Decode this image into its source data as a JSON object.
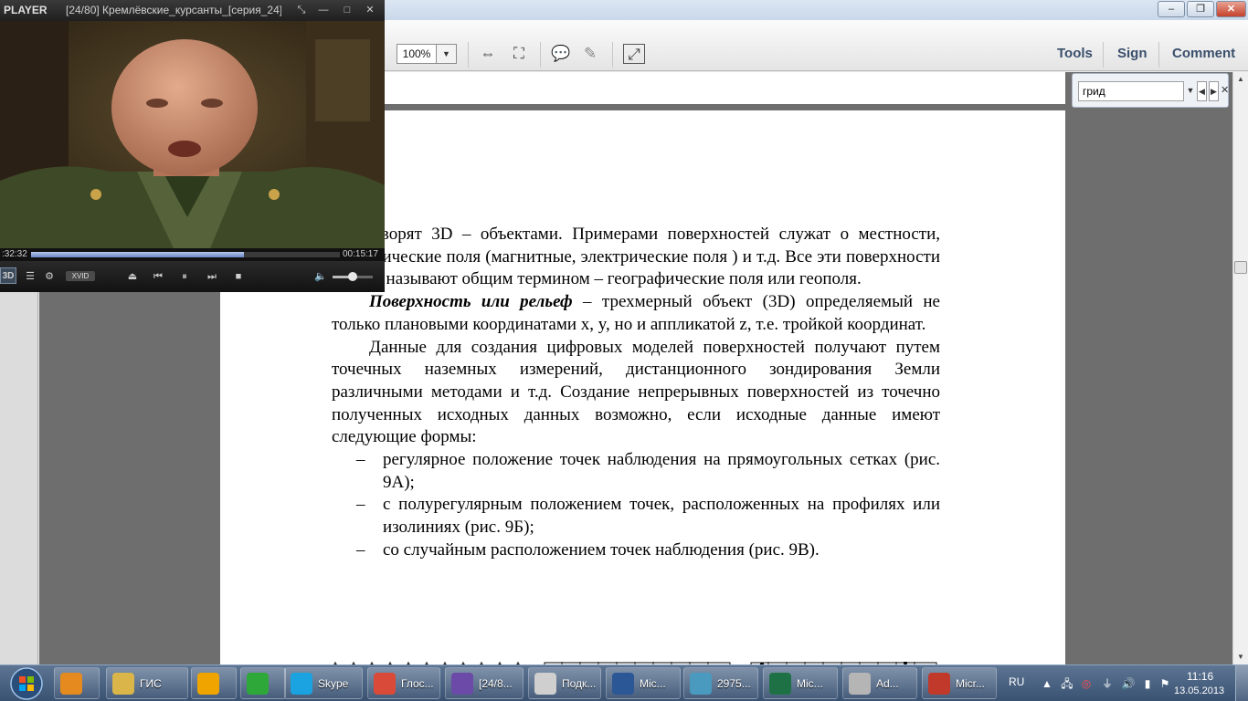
{
  "acrobat": {
    "zoom": "100%",
    "toolbar_tabs": {
      "tools": "Tools",
      "sign": "Sign",
      "comment": "Comment"
    },
    "find": {
      "query": "грид"
    }
  },
  "document": {
    "p1": "как говорят 3D – объектами. Примерами поверхностей служат о местности, геофизические поля (магнитные, электрические поля ) и т.д. Все эти поверхности иногда называют общим термином – географические поля или геополя.",
    "p2_term": "Поверхность или рельеф",
    "p2_rest": " – трехмерный объект (3D) определяемый не только плановыми координатами x, y, но и аппликатой z, т.е. тройкой координат.",
    "p3": "Данные для создания цифровых моделей поверхностей получают путем точечных наземных измерений, дистанционного зондирования Земли различными методами и т.д. Создание непрерывных поверхностей из точечно полученных исходных данных возможно, если исходные данные имеют следующие формы:",
    "bullet_dash": "–",
    "bullets": [
      "регулярное положение точек наблюдения на прямоугольных сетках (рис. 9А);",
      "с полурегулярным положением точек, расположенных на профилях или изолиниях (рис. 9Б);",
      "со случайным расположением точек наблюдения (рис. 9В)."
    ]
  },
  "player": {
    "logo": "PLAYER",
    "title": "[24/80] Кремлёвские_курсанты_[серия_24]...",
    "time_elapsed": ":32:32",
    "time_total": "00:15:17",
    "progress": 0.69,
    "volume": 0.5,
    "badge_3d": "3D",
    "codec": "XVID"
  },
  "taskbar": {
    "items": [
      {
        "label": "",
        "icon": "chat-app-icon",
        "color": "#e58a1f"
      },
      {
        "label": "ГИС",
        "icon": "folder-icon",
        "color": "#d9b54a"
      },
      {
        "label": "",
        "icon": "aimp-icon",
        "color": "#f0a400"
      },
      {
        "label": "",
        "icon": "mail-agent-icon",
        "color": "#2fa83a"
      },
      {
        "label": "Skype",
        "icon": "skype-icon",
        "color": "#1aa3e0"
      },
      {
        "label": "Глос...",
        "icon": "chrome-icon",
        "color": "#d94a38"
      },
      {
        "label": "[24/8...",
        "icon": "media-player-icon",
        "color": "#6b4aa8"
      },
      {
        "label": "Подк...",
        "icon": "document-icon",
        "color": "#cfcfcf"
      },
      {
        "label": "Mic...",
        "icon": "word-icon",
        "color": "#2b5797"
      },
      {
        "label": "2975...",
        "icon": "image-viewer-icon",
        "color": "#4a9ac0"
      },
      {
        "label": "Mic...",
        "icon": "excel-icon",
        "color": "#1e7145"
      },
      {
        "label": "Ad...",
        "icon": "ico-editor-icon",
        "color": "#b5b5b5"
      },
      {
        "label": "Micr...",
        "icon": "acrobat-icon",
        "color": "#c0392b"
      }
    ],
    "lang": "RU",
    "time": "11:16",
    "date": "13.05.2013"
  }
}
